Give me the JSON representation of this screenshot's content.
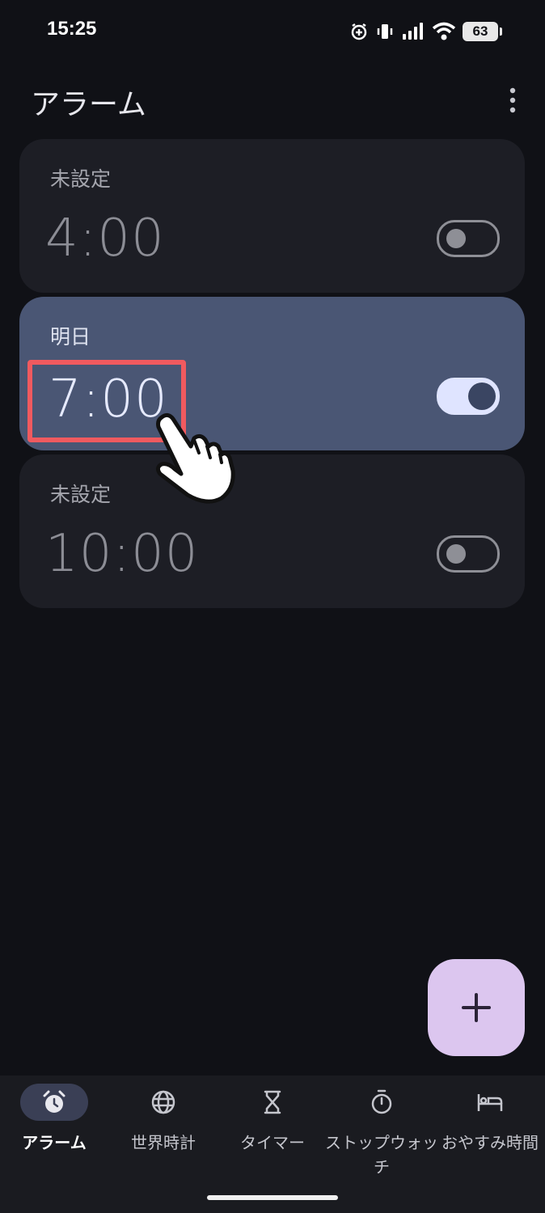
{
  "status_bar": {
    "time": "15:25",
    "battery_level": "63"
  },
  "app_bar": {
    "title": "アラーム"
  },
  "alarms": [
    {
      "label": "未設定",
      "time": "4:00",
      "enabled": false
    },
    {
      "label": "明日",
      "time": "7:00",
      "enabled": true
    },
    {
      "label": "未設定",
      "time": "10:00",
      "enabled": false
    }
  ],
  "bottom_nav": {
    "items": [
      {
        "label": "アラーム",
        "icon": "alarm-clock-icon",
        "active": true
      },
      {
        "label": "世界時計",
        "icon": "globe-icon",
        "active": false
      },
      {
        "label": "タイマー",
        "icon": "hourglass-icon",
        "active": false
      },
      {
        "label": "ストップウォッチ",
        "icon": "stopwatch-icon",
        "active": false
      },
      {
        "label": "おやすみ時間",
        "icon": "bed-icon",
        "active": false
      }
    ]
  },
  "colors": {
    "background": "#101116",
    "card": "#1d1e25",
    "card_active": "#4a5674",
    "fab": "#dcc6ef",
    "highlight": "#f05a5f"
  }
}
